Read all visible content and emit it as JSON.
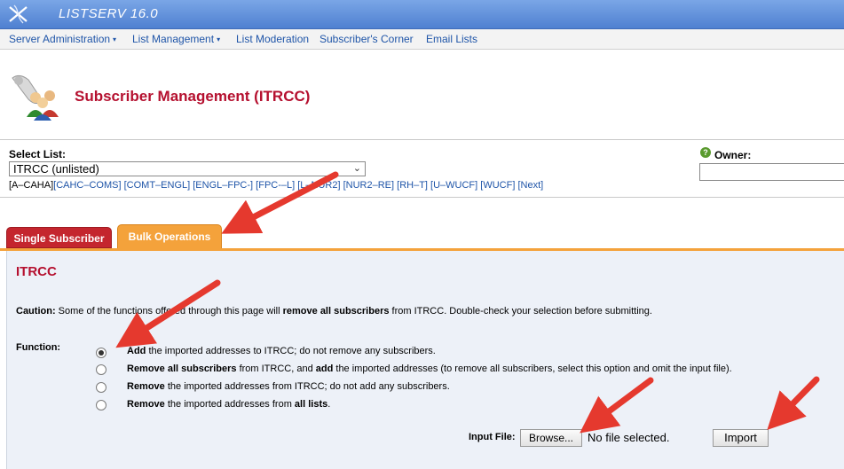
{
  "app": {
    "title": "LISTSERV 16.0"
  },
  "nav": [
    {
      "label": "Server Administration",
      "caret": "▾"
    },
    {
      "label": "List Management",
      "caret": "▾"
    },
    {
      "label": "List Moderation",
      "caret": ""
    },
    {
      "label": "Subscriber's Corner",
      "caret": ""
    },
    {
      "label": "Email Lists",
      "caret": ""
    }
  ],
  "page": {
    "title": "Subscriber Management (ITRCC)"
  },
  "select_list": {
    "label": "Select List:",
    "value": "ITRCC (unlisted)",
    "ranges_prefix": "[A–CAHA]",
    "ranges": [
      "[CAHC–COMS]",
      "[COMT–ENGL]",
      "[ENGL–FPC-]",
      "[FPC-–L]",
      "[L–NUR2]",
      "[NUR2–RE]",
      "[RH–T]",
      "[U–WUCF]",
      "[WUCF]",
      "[Next]"
    ]
  },
  "owner": {
    "label": "Owner:",
    "help": "?"
  },
  "tabs": {
    "single": "Single Subscriber",
    "bulk": "Bulk Operations"
  },
  "content": {
    "title": "ITRCC",
    "caution_label": "Caution:",
    "caution_text1": " Some of the functions offered through this page will ",
    "caution_bold": "remove all subscribers",
    "caution_text2": " from ITRCC. Double-check your selection before submitting.",
    "function_label": "Function:",
    "options": [
      {
        "b1": "Add",
        "t1": " the imported addresses to ITRCC; do not remove any subscribers.",
        "b2": "",
        "t2": "",
        "b3": "",
        "t3": ""
      },
      {
        "b1": "Remove all subscribers",
        "t1": " from ITRCC, and ",
        "b2": "add",
        "t2": " the imported addresses (to remove all subscribers, select this option and omit the input file).",
        "b3": "",
        "t3": ""
      },
      {
        "b1": "Remove",
        "t1": " the imported addresses from ITRCC; do not add any subscribers.",
        "b2": "",
        "t2": "",
        "b3": "",
        "t3": ""
      },
      {
        "b1": "Remove",
        "t1": " the imported addresses from ",
        "b2": "all lists",
        "t2": ".",
        "b3": "",
        "t3": ""
      }
    ],
    "input_file_label": "Input File:",
    "browse_label": "Browse...",
    "no_file_text": "No file selected.",
    "import_label": "Import"
  },
  "colors": {
    "accent_red": "#b5102f",
    "tab_orange": "#f4a23b",
    "tab_red": "#c4262e",
    "link_blue": "#1f55a8",
    "arrow_red": "#e5392e"
  }
}
